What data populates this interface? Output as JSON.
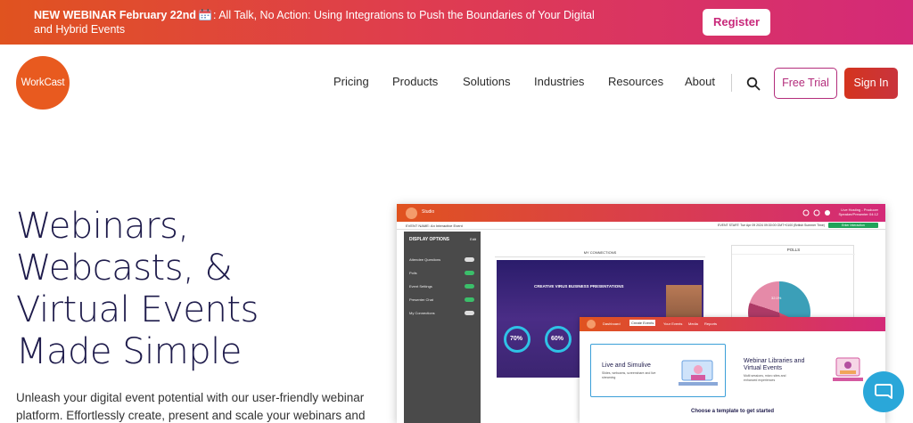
{
  "banner": {
    "highlight": "NEW WEBINAR February 22nd",
    "line1": ": All Talk, No Action: Using Integrations to Push the Boundaries of Your Digital",
    "line2": "and Hybrid Events",
    "register_label": "Register",
    "calendar_icon": "calendar-icon"
  },
  "header": {
    "logo_text": "WorkCast",
    "nav": [
      "Pricing",
      "Products",
      "Solutions",
      "Industries",
      "Resources",
      "About"
    ],
    "free_trial_label": "Free Trial",
    "sign_in_label": "Sign In",
    "search_icon": "search-icon"
  },
  "hero": {
    "title_lines": [
      "Webinars,",
      "Webcasts, &",
      "Virtual Events",
      "Made Simple"
    ],
    "subtitle_line1": "Unleash your digital event potential with our user-friendly webinar",
    "subtitle_line2": "platform. Effortlessly create, present and scale your webinars and"
  },
  "mockup": {
    "studio_label": "Studio",
    "top_right_1": "Live Hosting - Producer",
    "top_right_2": "Speaker/Presenter 04:12",
    "event_name": "EVENT NAME: An Interactive Event",
    "event_start": "EVENT START: Tue Apr 09 2024 09:30:00 GMT+0100 (British Summer Time)",
    "green_button": "Enter Interaction",
    "display_options": "DISPLAY OPTIONS",
    "display_edit": "Edit",
    "options": [
      "Attendee Questions",
      "Polls",
      "Event Settings",
      "Presenter Chat",
      "My Connections"
    ],
    "my_connections": "MY CONNECTIONS",
    "video_title": "CREATIVE VIRUS BUSINESS PRESENTATIONS",
    "ring_values": [
      "70%",
      "60%"
    ],
    "polls_title": "POLLS",
    "pie_labels": [
      "32.0%",
      "16.0%",
      "32.0%"
    ],
    "panel_tabs": [
      "Dashboard",
      "Create Events",
      "Your Events",
      "Media",
      "Reports"
    ],
    "card1_title": "Live and Simulive",
    "card1_desc_1": "Slides, webcams, screenshare and live",
    "card1_desc_2": "streaming",
    "card2_title_1": "Webinar Libraries and",
    "card2_title_2": "Virtual Events",
    "card2_desc_1": "Multi sessions, micro sites and",
    "card2_desc_2": "enhanced experiences",
    "choose_template": "Choose a template to get started"
  },
  "colors": {
    "brand_orange": "#e0531f",
    "brand_pink": "#d42a78",
    "heading_navy": "#1e1b4b",
    "chat_blue": "#2aa7d9"
  }
}
